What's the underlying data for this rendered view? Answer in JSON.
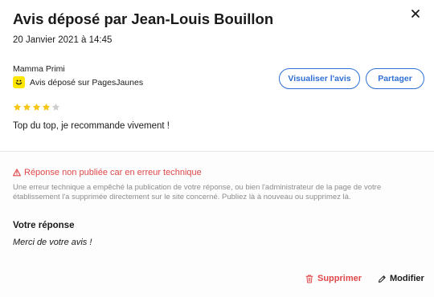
{
  "modal": {
    "title": "Avis déposé par Jean-Louis Bouillon",
    "date": "20 Janvier 2021 à 14:45",
    "close_icon": "close-icon"
  },
  "review": {
    "author": "Mamma Primi",
    "source_label": "Avis déposé sur PagesJaunes",
    "source_logo": "pagesjaunes-logo",
    "rating": 4,
    "rating_max": 5,
    "comment": "Top du top, je recommande vivement !"
  },
  "actions_top": {
    "view_label": "Visualiser l'avis",
    "share_label": "Partager"
  },
  "error": {
    "title": "Réponse non publiée car en erreur technique",
    "description": "Une erreur technique a empêché la publication de votre réponse, ou bien l'administrateur de la page de votre établissement l'a supprimée directement sur le site concerné. Publiez là à nouveau ou supprimez là.",
    "icon": "warning-icon"
  },
  "reply": {
    "label": "Votre réponse",
    "text": "Merci de votre avis !"
  },
  "actions_bottom": {
    "delete_label": "Supprimer",
    "edit_label": "Modifier"
  },
  "colors": {
    "accent": "#2f6fd6",
    "error": "#e0484a",
    "star_filled": "#f5c518",
    "star_empty": "#cfcfcf",
    "brand_pagesjaunes": "#ffe600"
  }
}
